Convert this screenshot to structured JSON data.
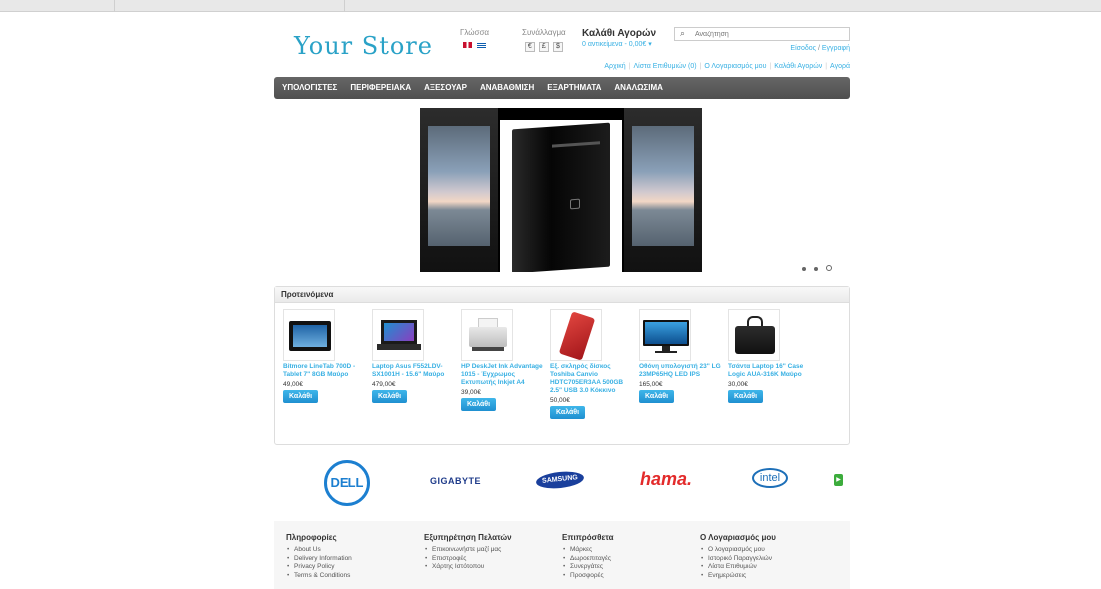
{
  "header": {
    "logo": "Your Store",
    "language_label": "Γλώσσα",
    "currency_label": "Συνάλλαγμα",
    "currencies": [
      "€",
      "£",
      "$"
    ],
    "cart_title": "Καλάθι Αγορών",
    "cart_summary": "0 αντικείμενα - 0,00€ ▾",
    "search_placeholder": "Αναζήτηση",
    "login": "Είσοδος",
    "register": "Εγγραφή",
    "top_links": [
      "Αρχική",
      "Λίστα Επιθυμιών (0)",
      "Ο Λογαριασμός μου",
      "Καλάθι Αγορών",
      "Αγορά"
    ]
  },
  "menu": [
    "ΥΠΟΛΟΓΙΣΤΕΣ",
    "ΠΕΡΙΦΕΡΕΙΑΚΑ",
    "ΑΞΕΣΟΥΑΡ",
    "ΑΝΑΒΑΘΜΙΣΗ",
    "ΕΞΑΡΤΗΜΑΤΑ",
    "ΑΝΑΛΩΣΙΜΑ"
  ],
  "featured": {
    "title": "Προτεινόμενα",
    "buy_label": "Καλάθι",
    "products": [
      {
        "name": "Bitmore LineTab 700D - Tablet 7\" 8GB Μαύρο",
        "price": "49,00€",
        "icon": "tablet-image"
      },
      {
        "name": "Laptop Asus F552LDV-SX1001H - 15.6\" Μαύρο",
        "price": "479,00€",
        "icon": "laptop-image"
      },
      {
        "name": "HP DeskJet Ink Advantage 1015 - Έγχρωμος Εκτυπωτής Inkjet A4",
        "price": "39,00€",
        "icon": "printer-image"
      },
      {
        "name": "Εξ. σκληρός δίσκος Toshiba Canvio HDTC705ER3AA 500GB 2.5\" USB 3.0 Κόκκινο",
        "price": "50,00€",
        "icon": "hard-drive-image"
      },
      {
        "name": "Οθόνη υπολογιστή 23\" LG 23MP65HQ LED IPS",
        "price": "165,00€",
        "icon": "monitor-image"
      },
      {
        "name": "Τσάντα Laptop 16\" Case Logic AUA-316K Μαύρο",
        "price": "30,00€",
        "icon": "laptop-bag-image"
      }
    ]
  },
  "brands": [
    "DELL",
    "GIGABYTE",
    "SAMSUNG",
    "hama.",
    "intel"
  ],
  "footer": {
    "columns": [
      {
        "title": "Πληροφορίες",
        "items": [
          "About Us",
          "Delivery Information",
          "Privacy Policy",
          "Terms & Conditions"
        ]
      },
      {
        "title": "Εξυπηρέτηση Πελατών",
        "items": [
          "Επικοινωνήστε μαζί μας",
          "Επιστροφές",
          "Χάρτης Ιστότοπου"
        ]
      },
      {
        "title": "Επιπρόσθετα",
        "items": [
          "Μάρκες",
          "Δωροεπιταγές",
          "Συνεργάτες",
          "Προσφορές"
        ]
      },
      {
        "title": "Ο Λογαριασμός μου",
        "items": [
          "Ο λογαριασμός μου",
          "Ιστορικό Παραγγελιών",
          "Λίστα Επιθυμιών",
          "Ενημερώσεις"
        ]
      }
    ]
  },
  "colors": {
    "accent": "#38b0e3",
    "menu_bg": "#5a5a5a",
    "buy_button": "#2a9fdc"
  }
}
